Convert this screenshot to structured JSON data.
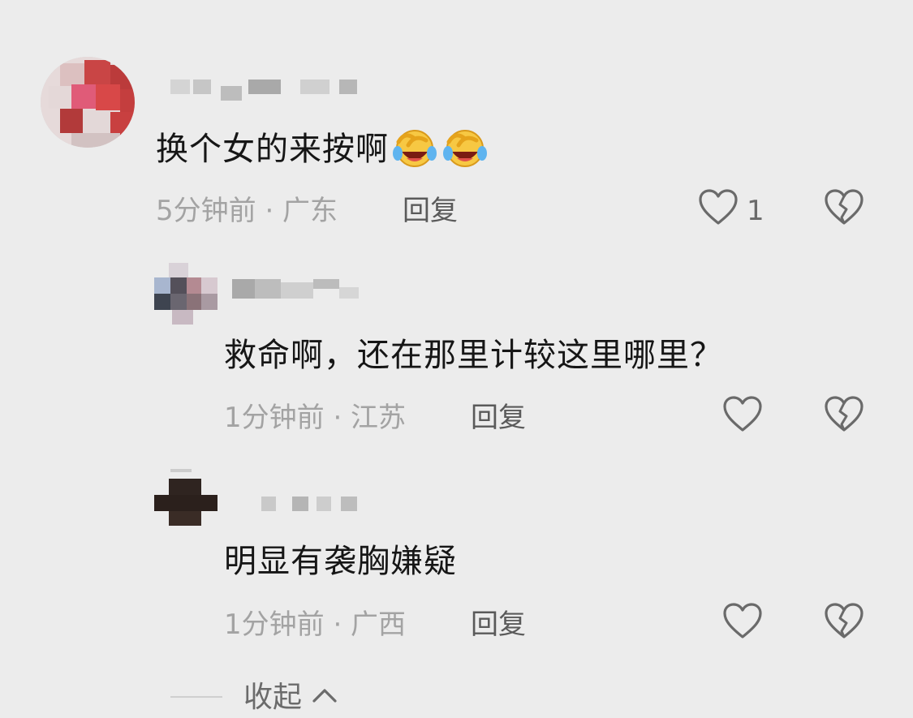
{
  "comments": [
    {
      "text": "换个女的来按啊",
      "emoji": [
        "laughing-crying-emoji",
        "laughing-crying-emoji"
      ],
      "meta": "5分钟前 · 广东",
      "reply_label": "回复",
      "like_count": "1"
    },
    {
      "text": "救命啊，还在那里计较这里哪里？",
      "meta": "1分钟前 · 江苏",
      "reply_label": "回复",
      "like_count": ""
    },
    {
      "text": "明显有袭胸嫌疑",
      "meta": "1分钟前 · 广西",
      "reply_label": "回复",
      "like_count": ""
    }
  ],
  "collapse_label": "收起",
  "icons": {
    "like": "heart-outline-icon",
    "dislike": "broken-heart-icon",
    "collapse": "chevron-up-icon"
  },
  "colors": {
    "background": "#ececec",
    "text": "#161616",
    "meta": "#a3a3a3",
    "icon": "#6a6a6a"
  }
}
